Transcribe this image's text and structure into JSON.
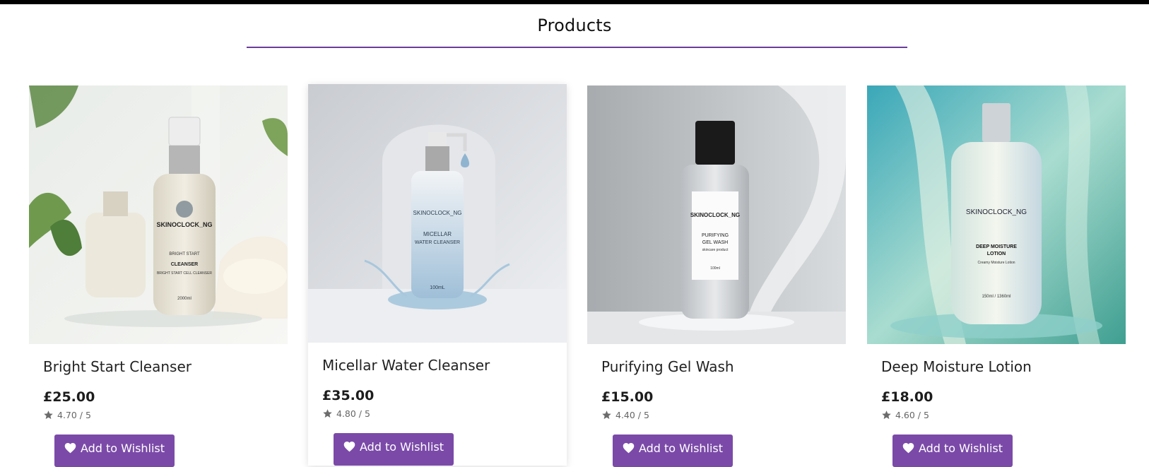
{
  "page": {
    "heading": "Products"
  },
  "colors": {
    "accent": "#7b4aa8",
    "rule": "#6a3d9a",
    "topbar": "#000000"
  },
  "products": [
    {
      "name": "Bright Start Cleanser",
      "price": "£25.00",
      "rating": "4.70 / 5",
      "wishlist_label": "Add to Wishlist",
      "image": {
        "brand": "SKINOCLOCK_NG",
        "line1": "BRIGHT START",
        "line2": "CLEANSER",
        "line3": "BRIGHT START CELL CLEANSER",
        "line4": "2000ml"
      }
    },
    {
      "name": "Micellar Water Cleanser",
      "price": "£35.00",
      "rating": "4.80 / 5",
      "wishlist_label": "Add to Wishlist",
      "image": {
        "brand": "SKINOCLOCK_NG",
        "line1": "MICELLAR",
        "line2": "WATER CLEANSER",
        "line3": "100mL"
      }
    },
    {
      "name": "Purifying Gel Wash",
      "price": "£15.00",
      "rating": "4.40 / 5",
      "wishlist_label": "Add to Wishlist",
      "image": {
        "brand": "SKINOCLOCK_NG",
        "line1": "PURIFYING",
        "line2": "GEL WASH",
        "line3": "skincare product",
        "line4": "100ml"
      }
    },
    {
      "name": "Deep Moisture Lotion",
      "price": "£18.00",
      "rating": "4.60 / 5",
      "wishlist_label": "Add to Wishlist",
      "image": {
        "brand": "SKINOCLOCK_NG",
        "line1": "DEEP MOISTURE",
        "line2": "LOTION",
        "line3": "Creamy Moisture Lotion",
        "line4": "150ml / 1360ml"
      }
    }
  ]
}
